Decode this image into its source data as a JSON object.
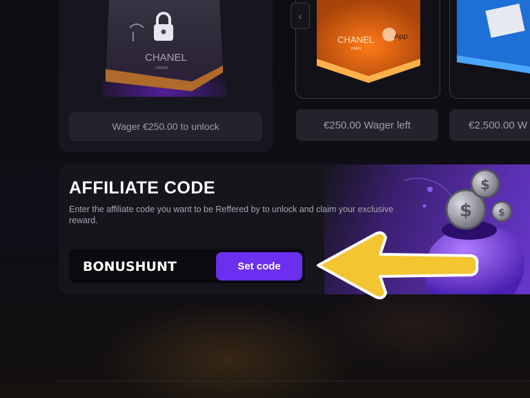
{
  "rewards": {
    "left_wager_text": "Wager €250.00 to unlock",
    "card_a_wager_text": "€250.00 Wager left",
    "card_b_wager_text": "€2,500.00 W",
    "box_brand_text": "CHANEL",
    "box_brand_sub": "PARIS",
    "box_b_brand_text": "CHANEL",
    "box_b_brand_sub": "PARIS",
    "apple_text": "App"
  },
  "affiliate": {
    "title": "AFFILIATE CODE",
    "description": "Enter the affiliate code you want to be Reffered by to unlock and claim your exclusive reward.",
    "code_value": "BONUSHUNT",
    "button_label": "Set code"
  },
  "colors": {
    "accent": "#6b2ff0",
    "arrow": "#f2c531"
  },
  "icons": [
    "chevron-left-icon",
    "lock-icon",
    "coin-icon",
    "arrow-left-icon"
  ]
}
